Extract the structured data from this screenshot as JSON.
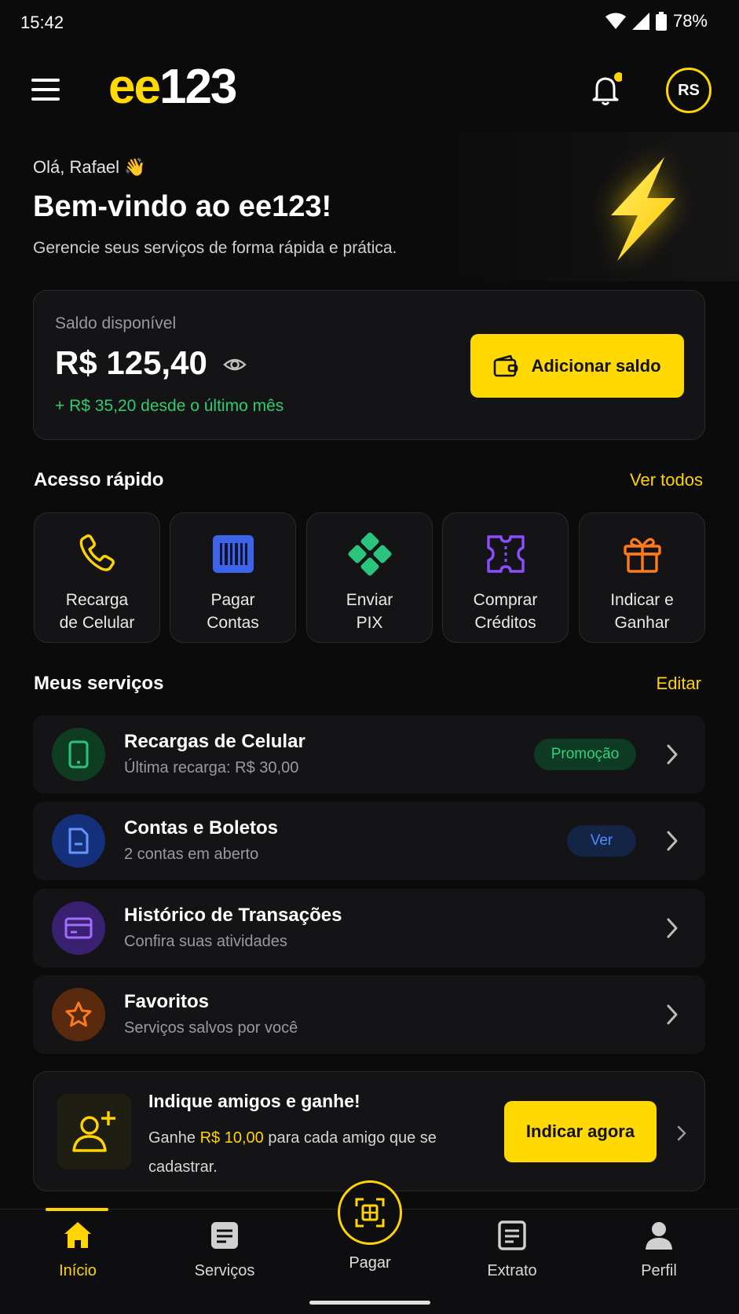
{
  "status_bar": {
    "time": "15:42",
    "battery": "78%"
  },
  "header": {
    "logo_accent": "ee",
    "logo_rest": "123",
    "avatar_initials": "RS"
  },
  "greeting": {
    "hello": "Olá, Rafael 👋",
    "title": "Bem-vindo ao ee123!",
    "subtitle": "Gerencie seus serviços de forma rápida e prática."
  },
  "balance": {
    "label": "Saldo disponível",
    "value": "R$ 125,40",
    "delta": "+ R$ 35,20 desde o último mês",
    "add_button": "Adicionar saldo"
  },
  "quick_access": {
    "title": "Acesso rápido",
    "see_all": "Ver todos",
    "items": [
      {
        "line1": "Recarga",
        "line2": "de Celular",
        "icon": "phone-icon",
        "color": "#ffd400"
      },
      {
        "line1": "Pagar",
        "line2": "Contas",
        "icon": "barcode-icon",
        "color": "#3d63e8"
      },
      {
        "line1": "Enviar",
        "line2": "PIX",
        "icon": "pix-icon",
        "color": "#2bc47d"
      },
      {
        "line1": "Comprar",
        "line2": "Créditos",
        "icon": "ticket-icon",
        "color": "#8b4dff"
      },
      {
        "line1": "Indicar e",
        "line2": "Ganhar",
        "icon": "gift-icon",
        "color": "#ff7a1a"
      }
    ]
  },
  "services": {
    "title": "Meus serviços",
    "edit": "Editar",
    "items": [
      {
        "title": "Recargas de Celular",
        "subtitle": "Última recarga: R$ 30,00",
        "badge": "Promoção",
        "icon": "smartphone-icon"
      },
      {
        "title": "Contas e Boletos",
        "subtitle": "2 contas em aberto",
        "badge": "Ver",
        "icon": "document-icon"
      },
      {
        "title": "Histórico de Transações",
        "subtitle": "Confira suas atividades",
        "icon": "card-icon"
      },
      {
        "title": "Favoritos",
        "subtitle": "Serviços salvos por você",
        "icon": "star-icon"
      }
    ]
  },
  "referral": {
    "title": "Indique amigos e ganhe!",
    "text_before": "Ganhe ",
    "text_highlight": "R$ 10,00",
    "text_after": " para cada amigo que se cadastrar.",
    "button": "Indicar agora"
  },
  "bottom_nav": {
    "items": [
      {
        "label": "Início",
        "icon": "home-icon"
      },
      {
        "label": "Serviços",
        "icon": "services-icon"
      },
      {
        "label": "Pagar",
        "icon": "qr-scan-icon"
      },
      {
        "label": "Extrato",
        "icon": "statement-icon"
      },
      {
        "label": "Perfil",
        "icon": "profile-icon"
      }
    ]
  },
  "colors": {
    "accent": "#ffd900",
    "background": "#0b0b0c",
    "card": "#141416",
    "positive": "#2ecc71"
  }
}
